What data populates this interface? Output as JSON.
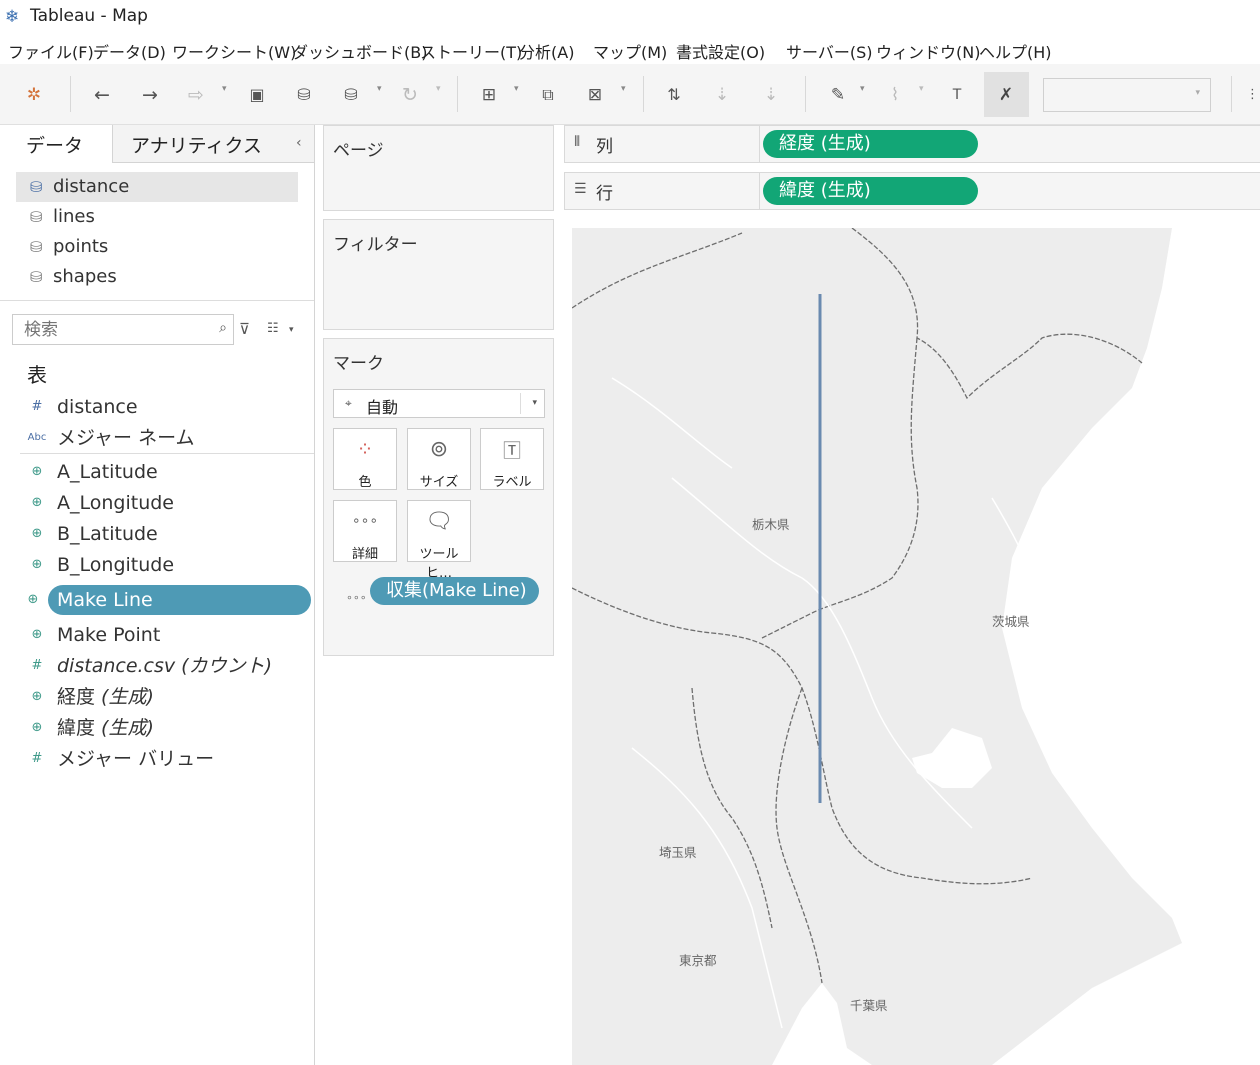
{
  "window": {
    "title": "Tableau - Map"
  },
  "menu": [
    "ファイル(F)",
    "データ(D)",
    "ワークシート(W)",
    "ダッシュボード(B)",
    "ストーリー(T)",
    "分析(A)",
    "マップ(M)",
    "書式設定(O)",
    "サーバー(S)",
    "ウィンドウ(N)",
    "ヘルプ(H)"
  ],
  "left_pane": {
    "tabs": {
      "data": "データ",
      "analytics": "アナリティクス"
    },
    "data_sources": [
      "distance",
      "lines",
      "points",
      "shapes"
    ],
    "search_placeholder": "検索",
    "section_title": "表",
    "fields": {
      "distance": "distance",
      "measure_names": "メジャー ネーム",
      "a_lat": "A_Latitude",
      "a_lon": "A_Longitude",
      "b_lat": "B_Latitude",
      "b_lon": "B_Longitude",
      "make_line": "Make Line",
      "make_point": "Make Point",
      "count_name": "distance.csv",
      "count_suffix": " (カウント)",
      "lon_name": "経度",
      "lon_suffix": " (生成)",
      "lat_name": "緯度",
      "lat_suffix": " (生成)",
      "measure_values": "メジャー バリュー"
    }
  },
  "cards": {
    "pages": "ページ",
    "filters": "フィルター",
    "marks": {
      "title": "マーク",
      "mark_type": "自動",
      "buttons": {
        "color": "色",
        "size": "サイズ",
        "label": "ラベル",
        "detail": "詳細",
        "tooltip": "ツールヒ…"
      },
      "detail_pill": "収集(Make Line)"
    }
  },
  "shelves": {
    "columns": {
      "label": "列",
      "pill": "経度 (生成)"
    },
    "rows": {
      "label": "行",
      "pill": "緯度 (生成)"
    }
  },
  "map": {
    "labels": {
      "tochigi": "栃木県",
      "ibaraki": "茨城県",
      "saitama": "埼玉県",
      "tokyo": "東京都",
      "chiba": "千葉県"
    },
    "line_color": "#6a8ab0"
  },
  "colors": {
    "accent_blue": "#4e9ab5",
    "accent_green": "#12a676"
  }
}
